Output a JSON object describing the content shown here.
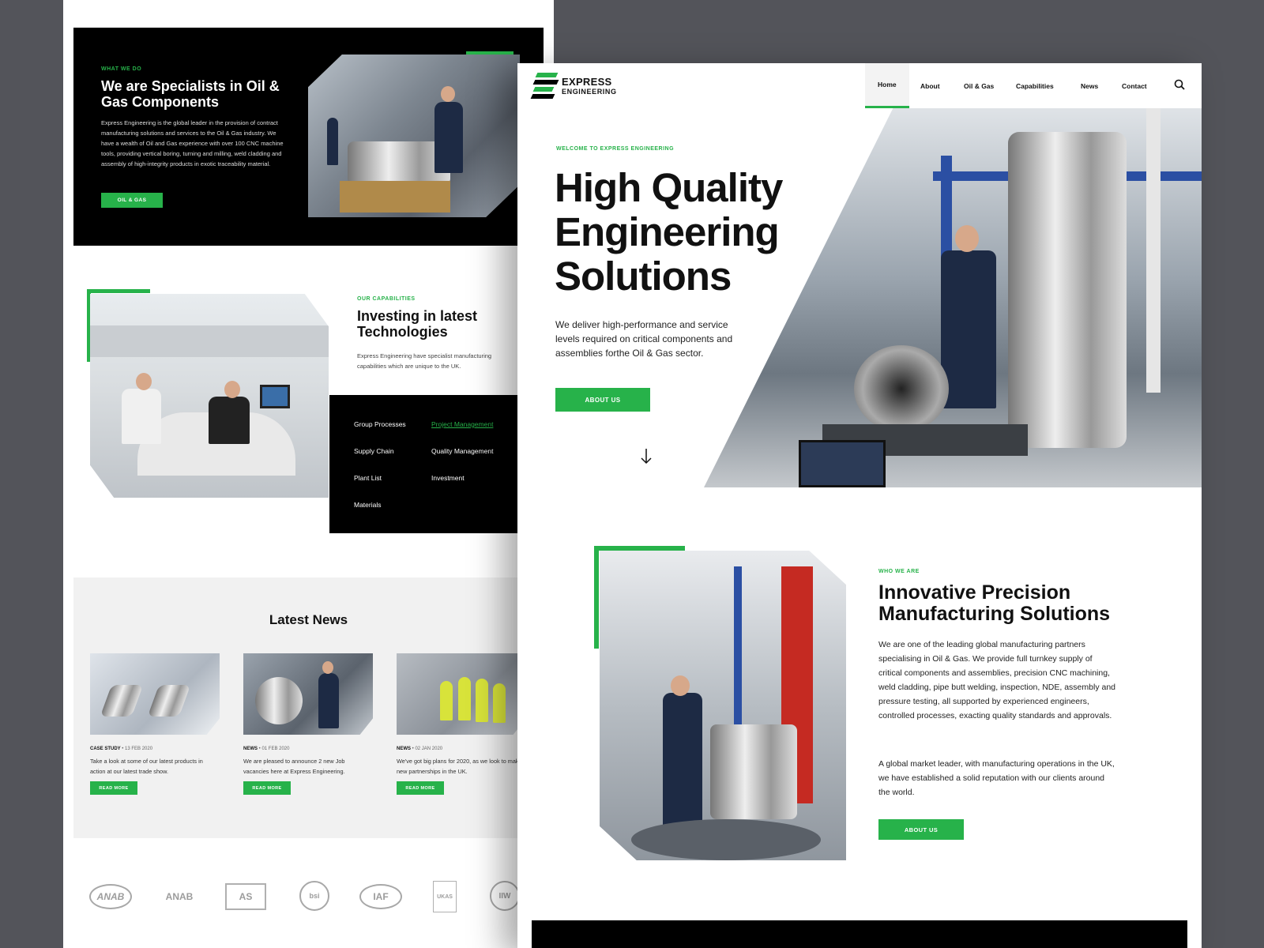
{
  "colors": {
    "accent": "#27b24a",
    "background": "#53545a",
    "dark": "#000000"
  },
  "back": {
    "what_we_do": {
      "eyebrow": "WHAT WE DO",
      "title": "We are Specialists in Oil & Gas Components",
      "body": "Express Engineering is the global leader in the provision of contract manufacturing solutions and services to the Oil & Gas industry. We have a wealth of Oil and Gas experience with over 100 CNC machine tools, providing vertical boring, turning and milling, weld cladding and assembly of high-integrity products in exotic traceability material.",
      "button": "OIL & GAS"
    },
    "capabilities": {
      "eyebrow": "OUR CAPABILITIES",
      "title": "Investing in latest Technologies",
      "body": "Express Engineering have specialist manufacturing capabilities which are unique to the UK.",
      "menu": [
        "Group Processes",
        "Project Management",
        "Supply Chain",
        "Quality Management",
        "Plant List",
        "Investment",
        "Materials"
      ]
    },
    "news": {
      "title": "Latest News",
      "cards": [
        {
          "tag": "CASE STUDY",
          "date": "13 FEB 2020",
          "text": "Take a look at some of our latest products in action at our latest trade show.",
          "button": "READ MORE"
        },
        {
          "tag": "NEWS",
          "date": "01 FEB 2020",
          "text": "We are pleased to announce 2 new Job vacancies here at Express Engineering.",
          "button": "READ MORE"
        },
        {
          "tag": "NEWS",
          "date": "02 JAN 2020",
          "text": "We've got big plans for 2020, as we look to make new partnerships in the UK.",
          "button": "READ MORE"
        }
      ]
    },
    "logos": [
      "ANAB",
      "ANAB",
      "AS",
      "bsi",
      "IAF",
      "UKAS",
      "IIW"
    ]
  },
  "front": {
    "brand": {
      "line1": "EXPRESS",
      "line2": "ENGINEERING"
    },
    "nav": [
      "Home",
      "About",
      "Oil & Gas",
      "Capabilities",
      "News",
      "Contact"
    ],
    "icons": {
      "search": "search-icon",
      "arrow": "arrow-down-icon"
    },
    "hero": {
      "eyebrow": "WELCOME TO EXPRESS ENGINEERING",
      "title": "High Quality Engineering Solutions",
      "subtitle": "We deliver high-performance and service levels required on critical components and assemblies forthe Oil & Gas sector.",
      "button": "ABOUT US"
    },
    "who_we_are": {
      "eyebrow": "WHO WE ARE",
      "title": "Innovative Precision Manufacturing Solutions",
      "p1": "We are one of the leading global manufacturing partners specialising in Oil & Gas. We provide full turnkey supply of critical components and assemblies, precision CNC machining, weld cladding, pipe butt welding, inspection, NDE, assembly and pressure testing, all supported by experienced engineers, controlled processes, exacting quality standards and approvals.",
      "p2": "A global market leader, with manufacturing operations in the UK, we have established a solid reputation with our clients around the world.",
      "button": "ABOUT US"
    }
  }
}
